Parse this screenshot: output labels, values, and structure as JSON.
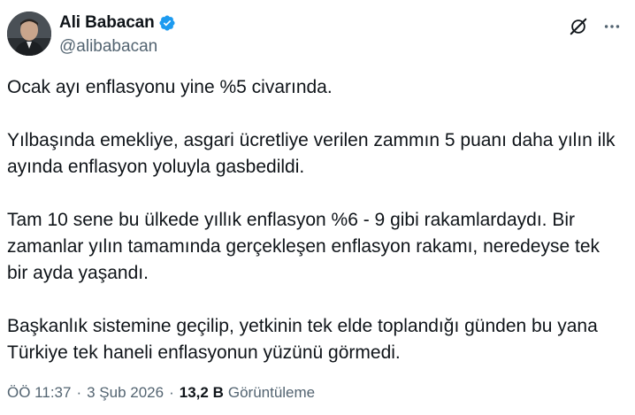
{
  "author": {
    "display_name": "Ali Babacan",
    "handle": "@alibabacan",
    "verified": true,
    "verified_color": "#1d9bf0"
  },
  "top_actions": {
    "grok_icon": "grok-icon",
    "more_icon": "more-icon"
  },
  "tweet": {
    "paragraphs": [
      "Ocak ayı enflasyonu yine %5 civarında.",
      "Yılbaşında emekliye, asgari ücretliye verilen zammın 5 puanı daha yılın ilk\nayında enflasyon yoluyla gasbedildi.",
      "Tam 10 sene bu ülkede yıllık enflasyon %6 - 9 gibi rakamlardaydı. Bir\nzamanlar yılın tamamında gerçekleşen enflasyon rakamı, neredeyse tek\nbir ayda yaşandı.",
      "Başkanlık sistemine geçilip, yetkinin tek elde toplandığı günden bu yana\nTürkiye tek haneli enflasyonun yüzünü görmedi."
    ]
  },
  "meta": {
    "time": "ÖÖ 11:37",
    "separator": "·",
    "date": "3 Şub 2026",
    "views_count": "13,2 B",
    "views_label": "Görüntüleme"
  },
  "colors": {
    "text_primary": "#0f1419",
    "text_secondary": "#536471",
    "background": "#ffffff"
  }
}
